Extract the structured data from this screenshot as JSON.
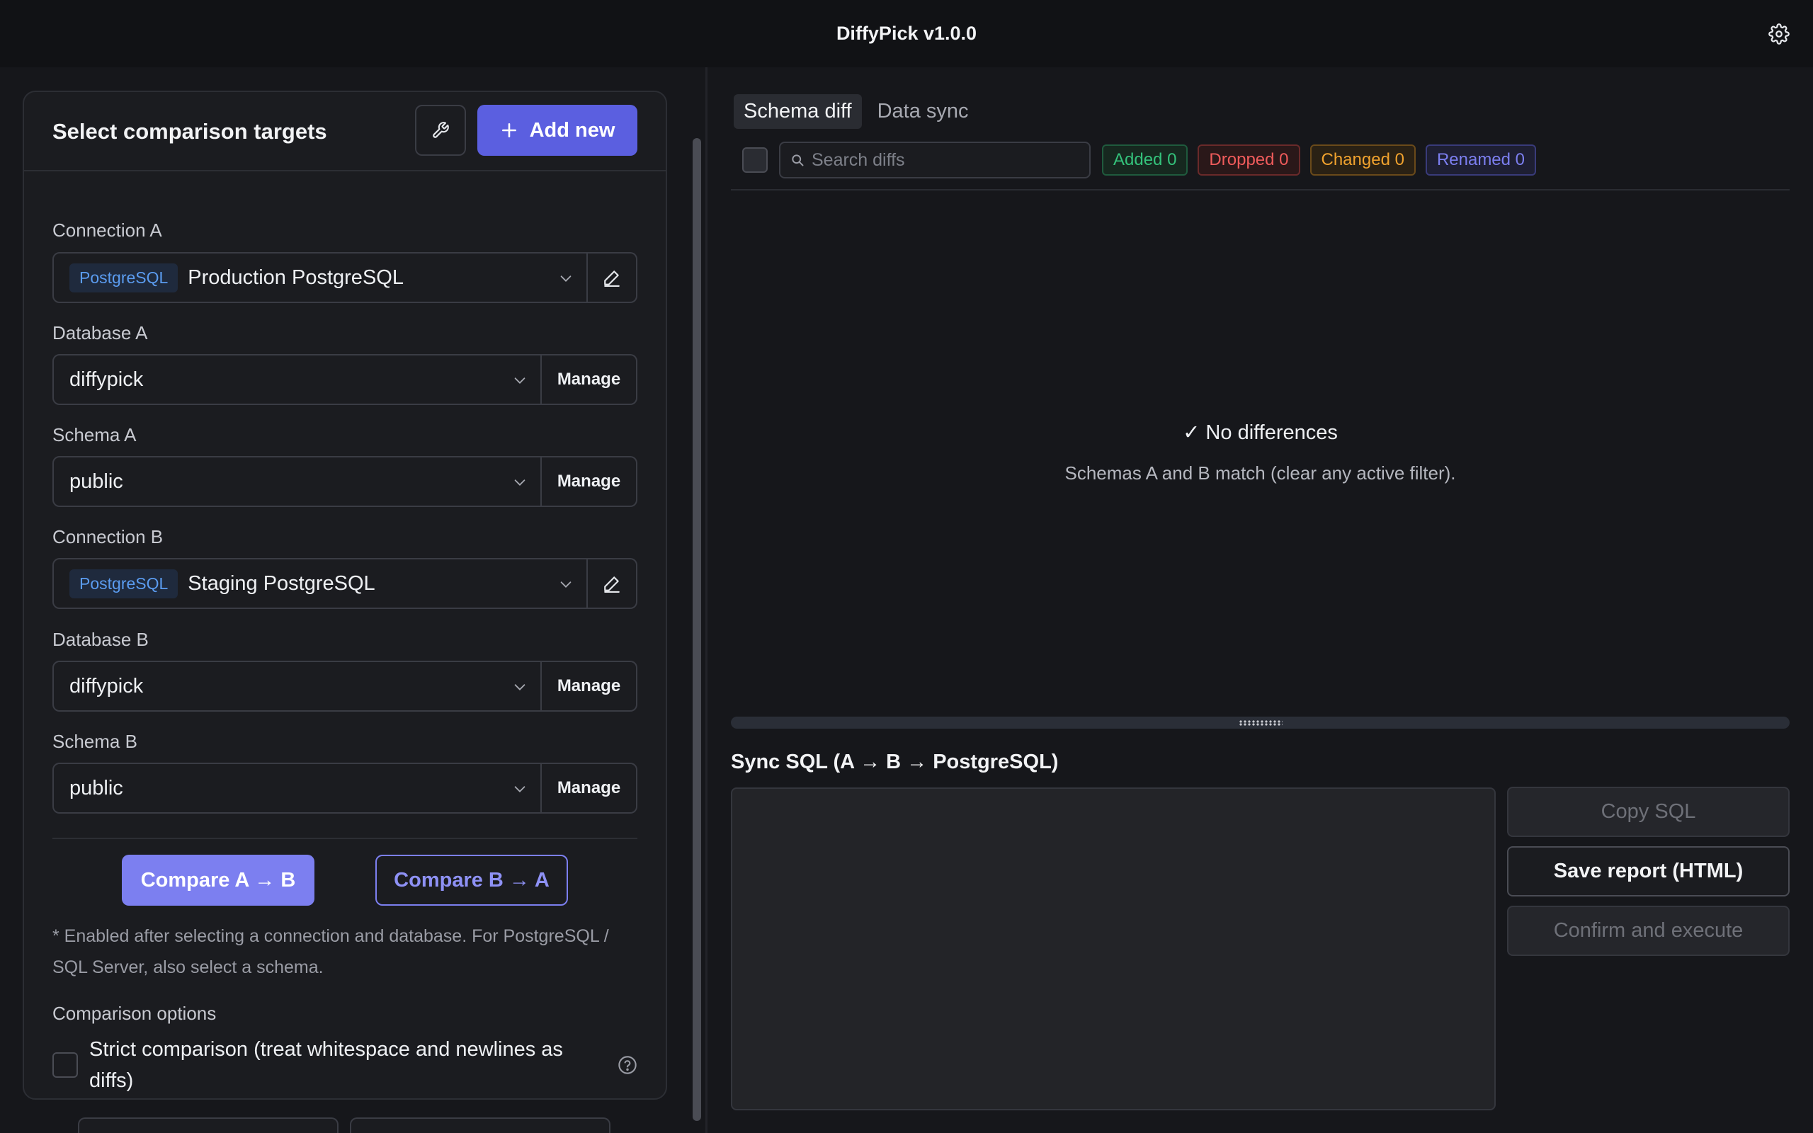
{
  "app": {
    "title": "DiffyPick v1.0.0"
  },
  "left": {
    "title": "Select comparison targets",
    "add_new_label": "Add new",
    "connection_a": {
      "label": "Connection A",
      "tag": "PostgreSQL",
      "value": "Production PostgreSQL"
    },
    "database_a": {
      "label": "Database A",
      "value": "diffypick",
      "manage": "Manage"
    },
    "schema_a": {
      "label": "Schema A",
      "value": "public",
      "manage": "Manage"
    },
    "connection_b": {
      "label": "Connection B",
      "tag": "PostgreSQL",
      "value": "Staging PostgreSQL"
    },
    "database_b": {
      "label": "Database B",
      "value": "diffypick",
      "manage": "Manage"
    },
    "schema_b": {
      "label": "Schema B",
      "value": "public",
      "manage": "Manage"
    },
    "compare_ab": "Compare A → B",
    "compare_ba": "Compare B → A",
    "note": "* Enabled after selecting a connection and database. For PostgreSQL / SQL Server, also select a schema.",
    "options_label": "Comparison options",
    "strict_label": "Strict comparison (treat whitespace and newlines as diffs)"
  },
  "right": {
    "tabs": [
      {
        "label": "Schema diff",
        "active": true
      },
      {
        "label": "Data sync",
        "active": false
      }
    ],
    "search": {
      "placeholder": "Search diffs",
      "value": ""
    },
    "badges": {
      "added": "Added 0",
      "dropped": "Dropped 0",
      "changed": "Changed 0",
      "renamed": "Renamed 0"
    },
    "empty": {
      "title": "✓ No differences",
      "subtitle": "Schemas A and B match (clear any active filter)."
    },
    "sql_title": "Sync SQL (A → B → PostgreSQL)",
    "actions": {
      "copy": "Copy SQL",
      "save": "Save report (HTML)",
      "execute": "Confirm and execute"
    }
  },
  "colors": {
    "accent": "#5b5fe0",
    "accent_light": "#7c7ff0",
    "added": "#34c27b",
    "dropped": "#ef5b5b",
    "changed": "#f0a22e",
    "renamed": "#7c7ff0",
    "pg_tag": "#5b9cf0"
  }
}
